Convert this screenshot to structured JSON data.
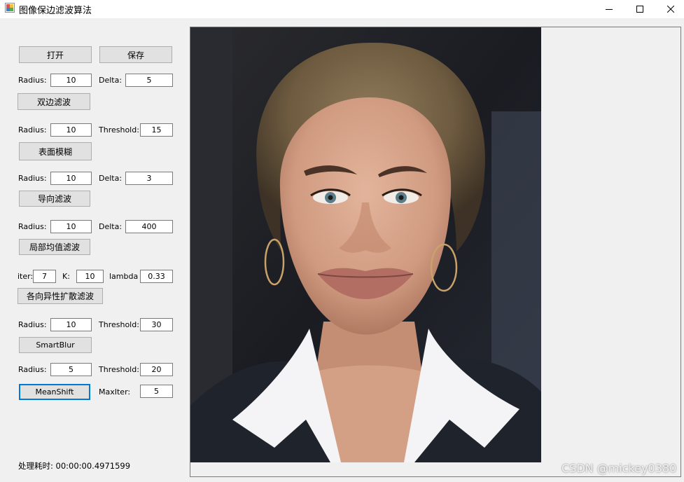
{
  "window": {
    "title": "图像保边滤波算法",
    "controls": [
      "minimize-icon",
      "maximize-icon",
      "close-icon"
    ]
  },
  "toolbar": {
    "open_label": "打开",
    "save_label": "保存"
  },
  "bilateral": {
    "radius_label": "Radius:",
    "radius_value": "10",
    "delta_label": "Delta:",
    "delta_value": "5",
    "button_label": "双边滤波"
  },
  "surface_blur": {
    "radius_label": "Radius:",
    "radius_value": "10",
    "threshold_label": "Threshold:",
    "threshold_value": "15",
    "button_label": "表面模糊"
  },
  "guided": {
    "radius_label": "Radius:",
    "radius_value": "10",
    "delta_label": "Delta:",
    "delta_value": "3",
    "button_label": "导向滤波"
  },
  "local_mean": {
    "radius_label": "Radius:",
    "radius_value": "10",
    "delta_label": "Delta:",
    "delta_value": "400",
    "button_label": "局部均值滤波"
  },
  "anisotropic": {
    "iter_label": "iter:",
    "iter_value": "7",
    "k_label": "K:",
    "k_value": "10",
    "lambda_label": "lambda",
    "lambda_value": "0.33",
    "button_label": "各向异性扩散滤波"
  },
  "smart_blur": {
    "radius_label": "Radius:",
    "radius_value": "10",
    "threshold_label": "Threshold:",
    "threshold_value": "30",
    "button_label": "SmartBlur"
  },
  "mean_shift": {
    "radius_label": "Radius:",
    "radius_value": "5",
    "threshold_label": "Threshold:",
    "threshold_value": "20",
    "button_label": "MeanShift",
    "maxiter_label": "MaxIter:",
    "maxiter_value": "5"
  },
  "status": {
    "elapsed_text": "处理耗时: 00:00:00.4971599"
  },
  "watermark": "CSDN @mickey0380",
  "colors": {
    "accent": "#0078d7",
    "background": "#f0f0f0",
    "button": "#e1e1e1"
  }
}
